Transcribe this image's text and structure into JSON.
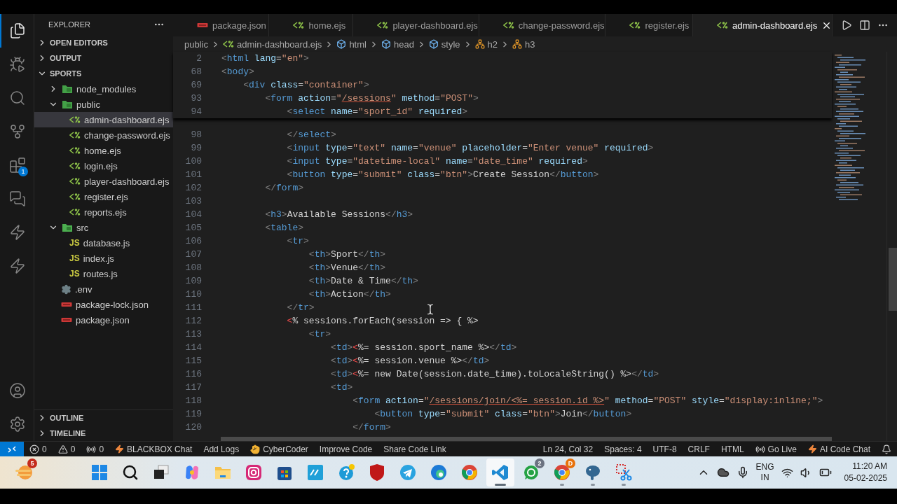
{
  "activity_bar": [
    {
      "kind": "files",
      "selected": true
    },
    {
      "kind": "debug",
      "selected": false
    },
    {
      "kind": "search",
      "selected": false
    },
    {
      "kind": "source-control",
      "selected": false
    },
    {
      "kind": "extensions",
      "selected": false,
      "badge": "1"
    },
    {
      "kind": "chat",
      "selected": false
    },
    {
      "kind": "bolt",
      "selected": false
    },
    {
      "kind": "lightning",
      "selected": false
    }
  ],
  "activity_bottom": [
    {
      "kind": "account"
    },
    {
      "kind": "settings"
    }
  ],
  "sidebar": {
    "title": "EXPLORER",
    "sections_top": [
      {
        "label": "OPEN EDITORS",
        "expanded": false
      },
      {
        "label": "OUTPUT",
        "expanded": false
      }
    ],
    "workspace": {
      "label": "SPORTS",
      "expanded": true
    },
    "tree": [
      {
        "label": "node_modules",
        "kind": "folder",
        "expanded": false,
        "selected": false
      },
      {
        "label": "public",
        "kind": "folder",
        "expanded": true,
        "selected": false,
        "children": [
          {
            "label": "admin-dashboard.ejs",
            "kind": "ejs",
            "selected": true
          },
          {
            "label": "change-password.ejs",
            "kind": "ejs",
            "selected": false
          },
          {
            "label": "home.ejs",
            "kind": "ejs",
            "selected": false
          },
          {
            "label": "login.ejs",
            "kind": "ejs",
            "selected": false
          },
          {
            "label": "player-dashboard.ejs",
            "kind": "ejs",
            "selected": false
          },
          {
            "label": "register.ejs",
            "kind": "ejs",
            "selected": false
          },
          {
            "label": "reports.ejs",
            "kind": "ejs",
            "selected": false
          }
        ]
      },
      {
        "label": "src",
        "kind": "folder",
        "expanded": true,
        "selected": false,
        "children": [
          {
            "label": "database.js",
            "kind": "js",
            "icon_label": "JS",
            "selected": false
          },
          {
            "label": "index.js",
            "kind": "js",
            "icon_label": "JS",
            "selected": false
          },
          {
            "label": "routes.js",
            "kind": "js",
            "icon_label": "JS",
            "selected": false
          }
        ]
      },
      {
        "label": ".env",
        "kind": "env",
        "selected": false
      },
      {
        "label": "package-lock.json",
        "kind": "json",
        "selected": false
      },
      {
        "label": "package.json",
        "kind": "json",
        "selected": false
      }
    ],
    "sections_bottom": [
      {
        "label": "OUTLINE",
        "expanded": false
      },
      {
        "label": "TIMELINE",
        "expanded": false
      }
    ]
  },
  "tabs": [
    {
      "label": "package.json",
      "kind": "json",
      "selected": false
    },
    {
      "label": "home.ejs",
      "kind": "ejs",
      "selected": false
    },
    {
      "label": "player-dashboard.ejs",
      "kind": "ejs",
      "selected": false
    },
    {
      "label": "change-password.ejs",
      "kind": "ejs",
      "selected": false
    },
    {
      "label": "register.ejs",
      "kind": "ejs",
      "selected": false
    },
    {
      "label": "admin-dashboard.ejs",
      "kind": "ejs",
      "selected": true
    }
  ],
  "breadcrumb": [
    {
      "label": "public",
      "kind": "folder"
    },
    {
      "label": "admin-dashboard.ejs",
      "kind": "ejs"
    },
    {
      "label": "html",
      "kind": "element"
    },
    {
      "label": "head",
      "kind": "element"
    },
    {
      "label": "style",
      "kind": "element"
    },
    {
      "label": "h2",
      "kind": "struct"
    },
    {
      "label": "h3",
      "kind": "struct"
    }
  ],
  "sticky_lines": [
    {
      "n": "2",
      "tokens": [
        {
          "kind": "punct",
          "text": "<"
        },
        {
          "kind": "tag",
          "text": "html"
        },
        {
          "kind": "attr",
          "text": " lang"
        },
        {
          "kind": "plain",
          "text": "="
        },
        {
          "kind": "string",
          "text": "\"en\""
        },
        {
          "kind": "punct",
          "text": ">"
        }
      ]
    },
    {
      "n": "68",
      "tokens": [
        {
          "kind": "punct",
          "text": "<"
        },
        {
          "kind": "tag",
          "text": "body"
        },
        {
          "kind": "punct",
          "text": ">"
        }
      ]
    },
    {
      "n": "69",
      "tokens": [
        {
          "kind": "punct",
          "text": "    <"
        },
        {
          "kind": "tag",
          "text": "div"
        },
        {
          "kind": "attr",
          "text": " class"
        },
        {
          "kind": "plain",
          "text": "="
        },
        {
          "kind": "string",
          "text": "\"container\""
        },
        {
          "kind": "punct",
          "text": ">"
        }
      ]
    },
    {
      "n": "93",
      "tokens": [
        {
          "kind": "punct",
          "text": "        <"
        },
        {
          "kind": "tag",
          "text": "form"
        },
        {
          "kind": "attr",
          "text": " action"
        },
        {
          "kind": "plain",
          "text": "="
        },
        {
          "kind": "string",
          "text": "\""
        },
        {
          "kind": "link",
          "text": "/sessions"
        },
        {
          "kind": "string",
          "text": "\""
        },
        {
          "kind": "attr",
          "text": " method"
        },
        {
          "kind": "plain",
          "text": "="
        },
        {
          "kind": "string",
          "text": "\"POST\""
        },
        {
          "kind": "punct",
          "text": ">"
        }
      ]
    },
    {
      "n": "94",
      "tokens": [
        {
          "kind": "punct",
          "text": "            <"
        },
        {
          "kind": "tag",
          "text": "select"
        },
        {
          "kind": "attr",
          "text": " name"
        },
        {
          "kind": "plain",
          "text": "="
        },
        {
          "kind": "string",
          "text": "\"sport_id\""
        },
        {
          "kind": "attr",
          "text": " required"
        },
        {
          "kind": "punct",
          "text": ">"
        }
      ]
    }
  ],
  "lines": [
    {
      "n": "98",
      "tokens": [
        {
          "kind": "punct",
          "text": "            </"
        },
        {
          "kind": "tag",
          "text": "select"
        },
        {
          "kind": "punct",
          "text": ">"
        }
      ]
    },
    {
      "n": "99",
      "tokens": [
        {
          "kind": "punct",
          "text": "            <"
        },
        {
          "kind": "tag",
          "text": "input"
        },
        {
          "kind": "attr",
          "text": " type"
        },
        {
          "kind": "plain",
          "text": "="
        },
        {
          "kind": "string",
          "text": "\"text\""
        },
        {
          "kind": "attr",
          "text": " name"
        },
        {
          "kind": "plain",
          "text": "="
        },
        {
          "kind": "string",
          "text": "\"venue\""
        },
        {
          "kind": "attr",
          "text": " placeholder"
        },
        {
          "kind": "plain",
          "text": "="
        },
        {
          "kind": "string",
          "text": "\"Enter venue\""
        },
        {
          "kind": "attr",
          "text": " required"
        },
        {
          "kind": "punct",
          "text": ">"
        }
      ]
    },
    {
      "n": "100",
      "tokens": [
        {
          "kind": "punct",
          "text": "            <"
        },
        {
          "kind": "tag",
          "text": "input"
        },
        {
          "kind": "attr",
          "text": " type"
        },
        {
          "kind": "plain",
          "text": "="
        },
        {
          "kind": "string",
          "text": "\"datetime-local\""
        },
        {
          "kind": "attr",
          "text": " name"
        },
        {
          "kind": "plain",
          "text": "="
        },
        {
          "kind": "string",
          "text": "\"date_time\""
        },
        {
          "kind": "attr",
          "text": " required"
        },
        {
          "kind": "punct",
          "text": ">"
        }
      ]
    },
    {
      "n": "101",
      "tokens": [
        {
          "kind": "punct",
          "text": "            <"
        },
        {
          "kind": "tag",
          "text": "button"
        },
        {
          "kind": "attr",
          "text": " type"
        },
        {
          "kind": "plain",
          "text": "="
        },
        {
          "kind": "string",
          "text": "\"submit\""
        },
        {
          "kind": "attr",
          "text": " class"
        },
        {
          "kind": "plain",
          "text": "="
        },
        {
          "kind": "string",
          "text": "\"btn\""
        },
        {
          "kind": "punct",
          "text": ">"
        },
        {
          "kind": "plain",
          "text": "Create Session"
        },
        {
          "kind": "punct",
          "text": "</"
        },
        {
          "kind": "tag",
          "text": "button"
        },
        {
          "kind": "punct",
          "text": ">"
        }
      ]
    },
    {
      "n": "102",
      "tokens": [
        {
          "kind": "punct",
          "text": "        </"
        },
        {
          "kind": "tag",
          "text": "form"
        },
        {
          "kind": "punct",
          "text": ">"
        }
      ]
    },
    {
      "n": "103"
    },
    {
      "n": "104",
      "tokens": [
        {
          "kind": "punct",
          "text": "        <"
        },
        {
          "kind": "tag",
          "text": "h3"
        },
        {
          "kind": "punct",
          "text": ">"
        },
        {
          "kind": "plain",
          "text": "Available Sessions"
        },
        {
          "kind": "punct",
          "text": "</"
        },
        {
          "kind": "tag",
          "text": "h3"
        },
        {
          "kind": "punct",
          "text": ">"
        }
      ]
    },
    {
      "n": "105",
      "tokens": [
        {
          "kind": "punct",
          "text": "        <"
        },
        {
          "kind": "tag",
          "text": "table"
        },
        {
          "kind": "punct",
          "text": ">"
        }
      ]
    },
    {
      "n": "106",
      "tokens": [
        {
          "kind": "punct",
          "text": "            <"
        },
        {
          "kind": "tag",
          "text": "tr"
        },
        {
          "kind": "punct",
          "text": ">"
        }
      ]
    },
    {
      "n": "107",
      "tokens": [
        {
          "kind": "punct",
          "text": "                <"
        },
        {
          "kind": "tag",
          "text": "th"
        },
        {
          "kind": "punct",
          "text": ">"
        },
        {
          "kind": "plain",
          "text": "Sport"
        },
        {
          "kind": "punct",
          "text": "</"
        },
        {
          "kind": "tag",
          "text": "th"
        },
        {
          "kind": "punct",
          "text": ">"
        }
      ]
    },
    {
      "n": "108",
      "tokens": [
        {
          "kind": "punct",
          "text": "                <"
        },
        {
          "kind": "tag",
          "text": "th"
        },
        {
          "kind": "punct",
          "text": ">"
        },
        {
          "kind": "plain",
          "text": "Venue"
        },
        {
          "kind": "punct",
          "text": "</"
        },
        {
          "kind": "tag",
          "text": "th"
        },
        {
          "kind": "punct",
          "text": ">"
        }
      ]
    },
    {
      "n": "109",
      "tokens": [
        {
          "kind": "punct",
          "text": "                <"
        },
        {
          "kind": "tag",
          "text": "th"
        },
        {
          "kind": "punct",
          "text": ">"
        },
        {
          "kind": "plain",
          "text": "Date & Time"
        },
        {
          "kind": "punct",
          "text": "</"
        },
        {
          "kind": "tag",
          "text": "th"
        },
        {
          "kind": "punct",
          "text": ">"
        }
      ]
    },
    {
      "n": "110",
      "tokens": [
        {
          "kind": "punct",
          "text": "                <"
        },
        {
          "kind": "tag",
          "text": "th"
        },
        {
          "kind": "punct",
          "text": ">"
        },
        {
          "kind": "plain",
          "text": "Action"
        },
        {
          "kind": "punct",
          "text": "</"
        },
        {
          "kind": "tag",
          "text": "th"
        },
        {
          "kind": "punct",
          "text": ">"
        }
      ]
    },
    {
      "n": "111",
      "tokens": [
        {
          "kind": "punct",
          "text": "            </"
        },
        {
          "kind": "tag",
          "text": "tr"
        },
        {
          "kind": "punct",
          "text": ">"
        }
      ]
    },
    {
      "n": "112",
      "tokens": [
        {
          "kind": "ejs",
          "text": "            <"
        },
        {
          "kind": "plain",
          "text": "% sessions.forEach(session => { %>"
        }
      ]
    },
    {
      "n": "113",
      "tokens": [
        {
          "kind": "punct",
          "text": "                <"
        },
        {
          "kind": "tag",
          "text": "tr"
        },
        {
          "kind": "punct",
          "text": ">"
        }
      ]
    },
    {
      "n": "114",
      "tokens": [
        {
          "kind": "punct",
          "text": "                    <"
        },
        {
          "kind": "tag",
          "text": "td"
        },
        {
          "kind": "punct",
          "text": ">"
        },
        {
          "kind": "ejs",
          "text": "<"
        },
        {
          "kind": "plain",
          "text": "%= session.sport_name %>"
        },
        {
          "kind": "punct",
          "text": "</"
        },
        {
          "kind": "tag",
          "text": "td"
        },
        {
          "kind": "punct",
          "text": ">"
        }
      ]
    },
    {
      "n": "115",
      "tokens": [
        {
          "kind": "punct",
          "text": "                    <"
        },
        {
          "kind": "tag",
          "text": "td"
        },
        {
          "kind": "punct",
          "text": ">"
        },
        {
          "kind": "ejs",
          "text": "<"
        },
        {
          "kind": "plain",
          "text": "%= session.venue %>"
        },
        {
          "kind": "punct",
          "text": "</"
        },
        {
          "kind": "tag",
          "text": "td"
        },
        {
          "kind": "punct",
          "text": ">"
        }
      ]
    },
    {
      "n": "116",
      "tokens": [
        {
          "kind": "punct",
          "text": "                    <"
        },
        {
          "kind": "tag",
          "text": "td"
        },
        {
          "kind": "punct",
          "text": ">"
        },
        {
          "kind": "ejs",
          "text": "<"
        },
        {
          "kind": "plain",
          "text": "%= new Date(session.date_time).toLocaleString() %>"
        },
        {
          "kind": "punct",
          "text": "</"
        },
        {
          "kind": "tag",
          "text": "td"
        },
        {
          "kind": "punct",
          "text": ">"
        }
      ]
    },
    {
      "n": "117",
      "tokens": [
        {
          "kind": "punct",
          "text": "                    <"
        },
        {
          "kind": "tag",
          "text": "td"
        },
        {
          "kind": "punct",
          "text": ">"
        }
      ]
    },
    {
      "n": "118",
      "tokens": [
        {
          "kind": "punct",
          "text": "                        <"
        },
        {
          "kind": "tag",
          "text": "form"
        },
        {
          "kind": "attr",
          "text": " action"
        },
        {
          "kind": "plain",
          "text": "="
        },
        {
          "kind": "string",
          "text": "\""
        },
        {
          "kind": "link",
          "text": "/sessions/join/<%= session.id %>"
        },
        {
          "kind": "string",
          "text": "\""
        },
        {
          "kind": "attr",
          "text": " method"
        },
        {
          "kind": "plain",
          "text": "="
        },
        {
          "kind": "string",
          "text": "\"POST\""
        },
        {
          "kind": "attr",
          "text": " style"
        },
        {
          "kind": "plain",
          "text": "="
        },
        {
          "kind": "string",
          "text": "\"display:inline;\""
        },
        {
          "kind": "punct",
          "text": ">"
        }
      ]
    },
    {
      "n": "119",
      "tokens": [
        {
          "kind": "punct",
          "text": "                            <"
        },
        {
          "kind": "tag",
          "text": "button"
        },
        {
          "kind": "attr",
          "text": " type"
        },
        {
          "kind": "plain",
          "text": "="
        },
        {
          "kind": "string",
          "text": "\"submit\""
        },
        {
          "kind": "attr",
          "text": " class"
        },
        {
          "kind": "plain",
          "text": "="
        },
        {
          "kind": "string",
          "text": "\"btn\""
        },
        {
          "kind": "punct",
          "text": ">"
        },
        {
          "kind": "plain",
          "text": "Join"
        },
        {
          "kind": "punct",
          "text": "</"
        },
        {
          "kind": "tag",
          "text": "button"
        },
        {
          "kind": "punct",
          "text": ">"
        }
      ]
    },
    {
      "n": "120",
      "tokens": [
        {
          "kind": "punct",
          "text": "                        </"
        },
        {
          "kind": "tag",
          "text": "form"
        },
        {
          "kind": "punct",
          "text": ">"
        }
      ]
    }
  ],
  "status_left": [
    {
      "kind": "errors",
      "label": "0"
    },
    {
      "kind": "warnings",
      "label": "0"
    },
    {
      "kind": "ports",
      "label": "0"
    },
    {
      "kind": "bolt",
      "label": "BLACKBOX Chat"
    },
    {
      "kind": "plain",
      "label": "Add Logs"
    },
    {
      "kind": "hand",
      "label": "CyberCoder"
    },
    {
      "kind": "plain",
      "label": "Improve Code"
    },
    {
      "kind": "plain",
      "label": "Share Code Link"
    }
  ],
  "status_right": [
    {
      "kind": "plain",
      "label": "Ln 24, Col 32"
    },
    {
      "kind": "plain",
      "label": "Spaces: 4"
    },
    {
      "kind": "plain",
      "label": "UTF-8"
    },
    {
      "kind": "plain",
      "label": "CRLF"
    },
    {
      "kind": "plain",
      "label": "HTML"
    },
    {
      "kind": "live",
      "label": "Go Live"
    },
    {
      "kind": "bolt",
      "label": "AI Code Chat"
    },
    {
      "kind": "bell"
    }
  ],
  "taskbar": {
    "widget_badge": "5",
    "apps": [
      {
        "kind": "start",
        "running": false,
        "selected": false
      },
      {
        "kind": "search",
        "running": false,
        "selected": false
      },
      {
        "kind": "taskview",
        "running": false,
        "selected": false
      },
      {
        "kind": "copilot",
        "running": false,
        "selected": false
      },
      {
        "kind": "folder",
        "running": false,
        "selected": false
      },
      {
        "kind": "camera",
        "running": false,
        "selected": false
      },
      {
        "kind": "store",
        "running": false,
        "selected": false
      },
      {
        "kind": "hp",
        "running": false,
        "selected": false
      },
      {
        "kind": "help",
        "running": false,
        "selected": false
      },
      {
        "kind": "shield",
        "running": false,
        "selected": false
      },
      {
        "kind": "telegram",
        "running": false,
        "selected": false
      },
      {
        "kind": "edge",
        "running": false,
        "selected": false
      },
      {
        "kind": "chrome",
        "running": false,
        "selected": false
      },
      {
        "kind": "vscode",
        "running": true,
        "selected": true
      },
      {
        "kind": "whatsapp",
        "running": false,
        "selected": false,
        "badge": "2"
      },
      {
        "kind": "chrome",
        "running": true,
        "selected": false,
        "badge": "D"
      },
      {
        "kind": "elephant",
        "running": true,
        "selected": false
      },
      {
        "kind": "snip",
        "running": true,
        "selected": false
      }
    ],
    "language": [
      "ENG",
      "IN"
    ],
    "time": "11:20 AM",
    "date": "05-02-2025"
  }
}
